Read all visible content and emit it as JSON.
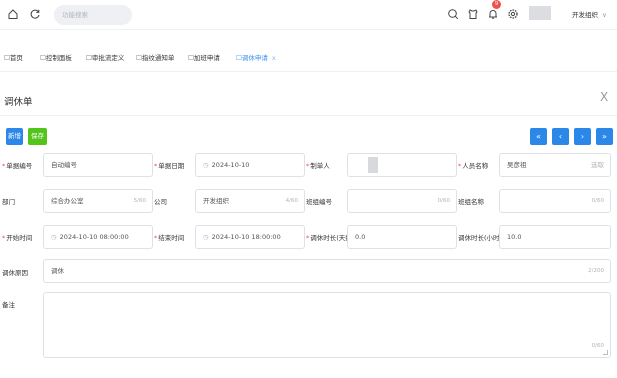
{
  "header": {
    "search_placeholder": "功能搜索",
    "notification_count": "9",
    "org_name": "开发组织",
    "org_caret": "∨"
  },
  "tabs": [
    {
      "label": "首页"
    },
    {
      "label": "控制面板"
    },
    {
      "label": "审批流定义"
    },
    {
      "label": "指纹通知单"
    },
    {
      "label": "加班申请"
    },
    {
      "label": "调休申请",
      "close": "x"
    }
  ],
  "form": {
    "title": "调休单",
    "close": "X",
    "buttons": {
      "new": "新增",
      "save": "保存"
    },
    "nav": [
      "«",
      "‹",
      "›",
      "»"
    ],
    "fields": {
      "doc_no": {
        "label": "单据编号",
        "value": "自动编号"
      },
      "doc_date": {
        "label": "单据日期",
        "value": "2024-10-10"
      },
      "creator": {
        "label": "制单人",
        "value": ""
      },
      "person": {
        "label": "人员名称",
        "value": "吴彦祖",
        "action": "选取"
      },
      "dept": {
        "label": "部门",
        "value": "综合办公室",
        "count": "5/60"
      },
      "company": {
        "label": "公司",
        "value": "开发组织",
        "count": "4/60"
      },
      "shift_no": {
        "label": "班组编号",
        "value": "",
        "count": "0/60"
      },
      "shift_name": {
        "label": "班组名称",
        "value": "",
        "count": "0/60"
      },
      "start_time": {
        "label": "开始时间",
        "value": "2024-10-10 08:00:00"
      },
      "end_time": {
        "label": "结束时间",
        "value": "2024-10-10 18:00:00"
      },
      "duration_days": {
        "label": "调休时长(天数)",
        "value": "0.0"
      },
      "duration_hours": {
        "label": "调休时长(小时)",
        "value": "10.0"
      },
      "reason": {
        "label": "调休原因",
        "value": "调休",
        "count": "2/200"
      },
      "remark": {
        "label": "备注",
        "value": "",
        "count": "0/60"
      }
    }
  },
  "colors": {
    "primary": "#2b87e8",
    "save": "#52c41a",
    "active_tab": "#3b8ef0",
    "required": "#f0514d"
  },
  "icons": [
    "home-icon",
    "refresh-icon",
    "search-icon",
    "shirt-icon",
    "bell-icon",
    "settings-icon",
    "calendar-icon"
  ]
}
